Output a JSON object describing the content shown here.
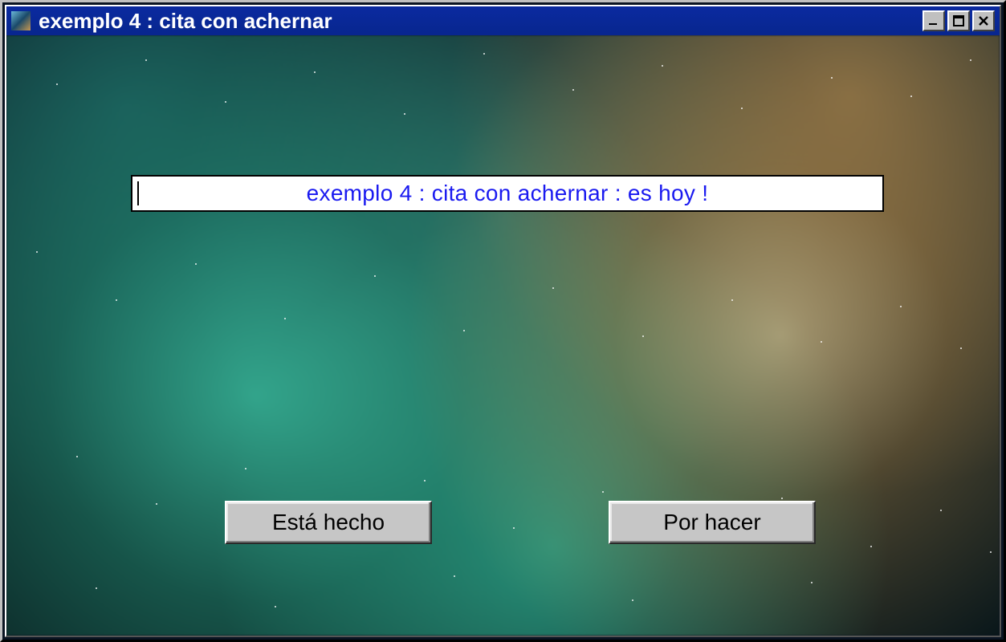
{
  "window": {
    "title": "exemplo 4 : cita con achernar"
  },
  "message": {
    "text": "exemplo 4 : cita con achernar   : es hoy !"
  },
  "buttons": {
    "done": "Está hecho",
    "todo": "Por hacer"
  }
}
